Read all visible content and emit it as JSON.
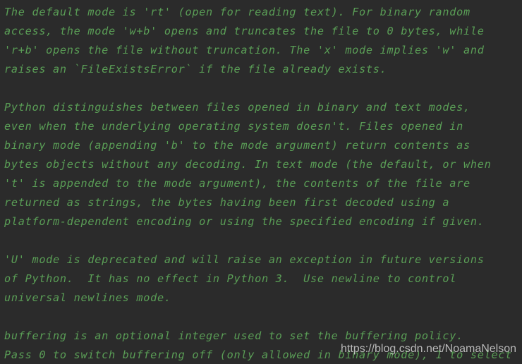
{
  "terminal": {
    "background_color": "#2b2b2b",
    "text_color": "#5a9e56",
    "doc_text": "The default mode is 'rt' (open for reading text). For binary random\naccess, the mode 'w+b' opens and truncates the file to 0 bytes, while\n'r+b' opens the file without truncation. The 'x' mode implies 'w' and\nraises an `FileExistsError` if the file already exists.\n\nPython distinguishes between files opened in binary and text modes,\neven when the underlying operating system doesn't. Files opened in\nbinary mode (appending 'b' to the mode argument) return contents as\nbytes objects without any decoding. In text mode (the default, or when\n't' is appended to the mode argument), the contents of the file are\nreturned as strings, the bytes having been first decoded using a\nplatform-dependent encoding or using the specified encoding if given.\n\n'U' mode is deprecated and will raise an exception in future versions\nof Python.  It has no effect in Python 3.  Use newline to control\nuniversal newlines mode.\n\nbuffering is an optional integer used to set the buffering policy.\nPass 0 to switch buffering off (only allowed in binary mode), 1 to select",
    "lines": [
      "The default mode is 'rt' (open for reading text). For binary random",
      "access, the mode 'w+b' opens and truncates the file to 0 bytes, while",
      "'r+b' opens the file without truncation. The 'x' mode implies 'w' and",
      "raises an `FileExistsError` if the file already exists.",
      "",
      "Python distinguishes between files opened in binary and text modes,",
      "even when the underlying operating system doesn't. Files opened in",
      "binary mode (appending 'b' to the mode argument) return contents as",
      "bytes objects without any decoding. In text mode (the default, or when",
      "'t' is appended to the mode argument), the contents of the file are",
      "returned as strings, the bytes having been first decoded using a",
      "platform-dependent encoding or using the specified encoding if given.",
      "",
      "'U' mode is deprecated and will raise an exception in future versions",
      "of Python.  It has no effect in Python 3.  Use newline to control",
      "universal newlines mode.",
      "",
      "buffering is an optional integer used to set the buffering policy.",
      "Pass 0 to switch buffering off (only allowed in binary mode), 1 to select"
    ]
  },
  "watermark": {
    "text": "https://blog.csdn.net/NoamaNelson",
    "color": "#e2e2e2"
  }
}
